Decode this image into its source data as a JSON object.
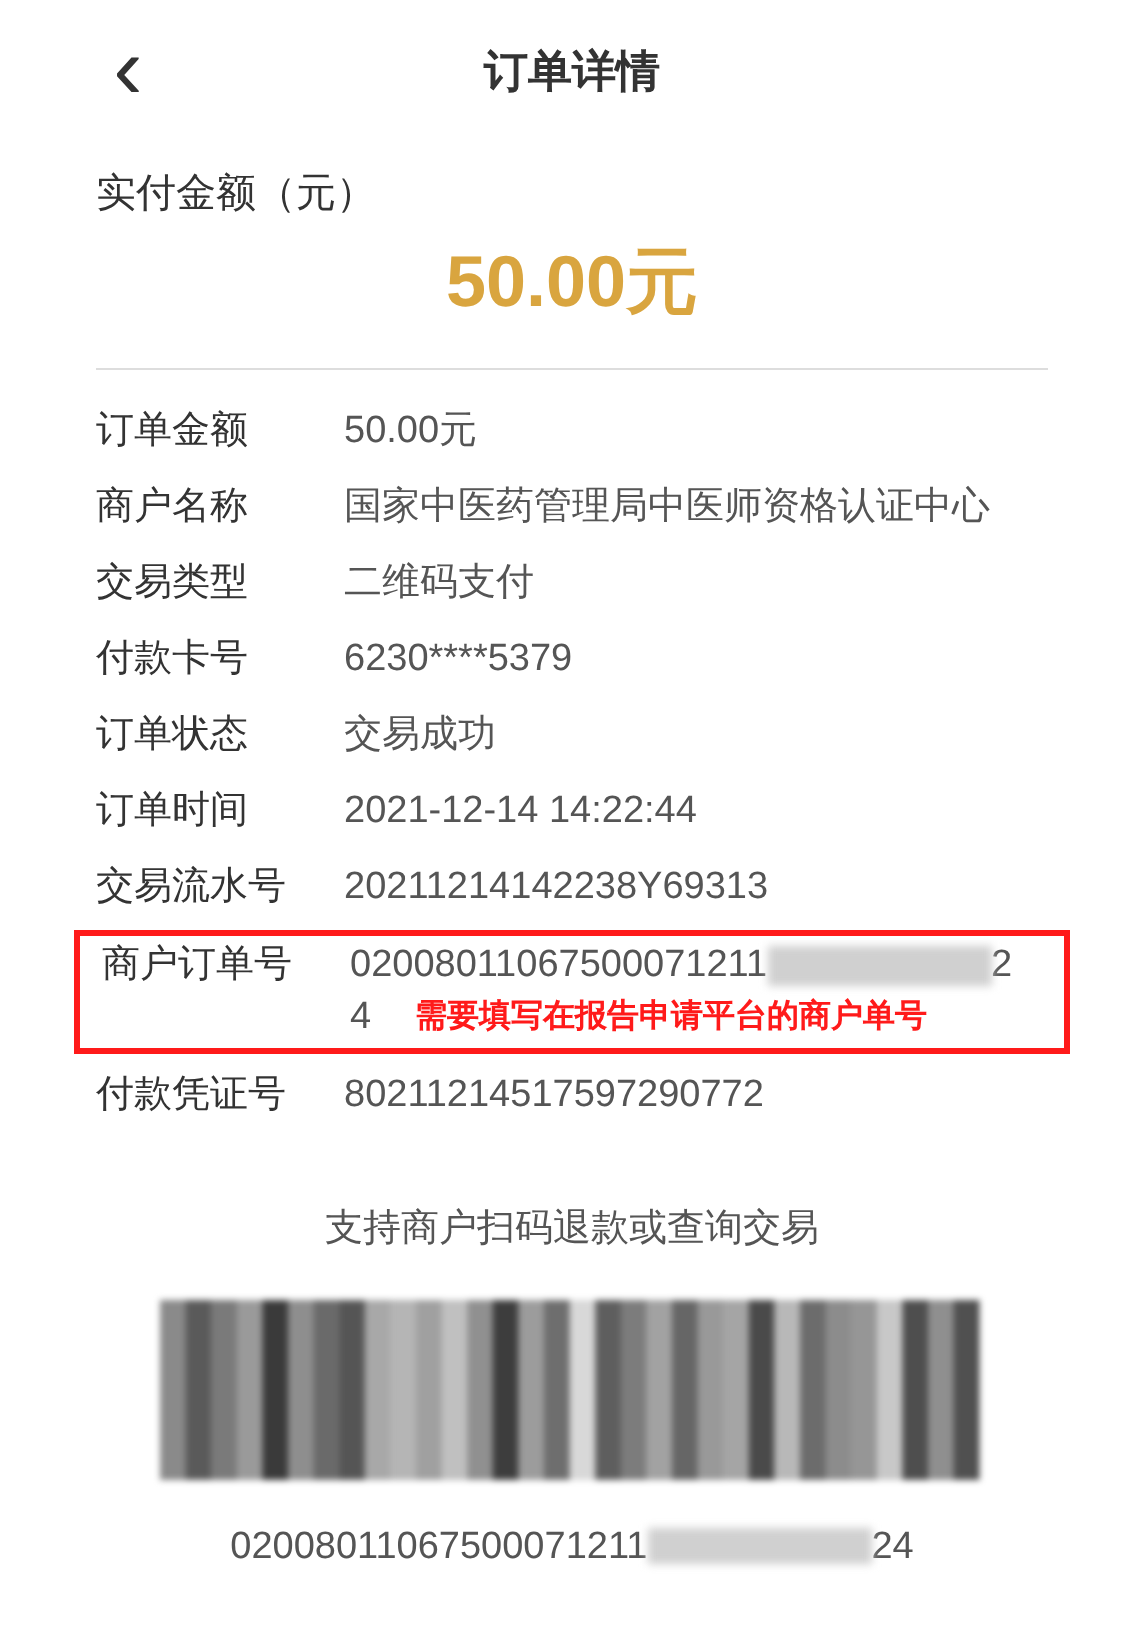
{
  "header": {
    "back": "‹",
    "title": "订单详情"
  },
  "amount": {
    "label": "实付金额（元）",
    "value": "50.00元"
  },
  "rows": [
    {
      "label": "订单金额",
      "value": "50.00元"
    },
    {
      "label": "商户名称",
      "value": "国家中医药管理局中医师资格认证中心"
    },
    {
      "label": "交易类型",
      "value": "二维码支付"
    },
    {
      "label": "付款卡号",
      "value": "6230****5379"
    },
    {
      "label": "订单状态",
      "value": "交易成功"
    },
    {
      "label": "订单时间",
      "value": "2021-12-14 14:22:44"
    },
    {
      "label": "交易流水号",
      "value": "20211214142238Y69313"
    },
    {
      "label": "商户订单号",
      "value": "02008011067500071211",
      "value_end": [
        "2",
        "4"
      ],
      "redacted": true,
      "highlighted": true,
      "note": "需要填写在报告申请平台的商户单号"
    },
    {
      "label": "付款凭证号",
      "value": "80211214517597290772"
    }
  ],
  "barcode": {
    "caption": "支持商户扫码退款或查询交易",
    "number": "02008011067500071211",
    "number_end": "24",
    "redacted": true
  }
}
